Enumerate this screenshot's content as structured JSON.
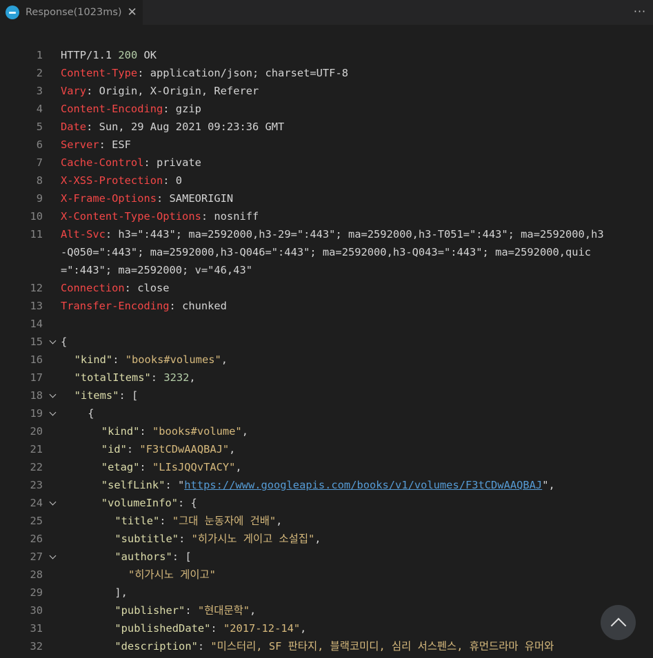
{
  "tab": {
    "icon": "rest-client-icon",
    "title": "Response(1023ms)",
    "close_glyph": "✕"
  },
  "more_glyph": "···",
  "lines": [
    {
      "n": "1",
      "fold": false,
      "indent": 0,
      "segments": [
        [
          "p",
          "HTTP/1.1 "
        ],
        [
          "n",
          "200"
        ],
        [
          "p",
          " OK"
        ]
      ]
    },
    {
      "n": "2",
      "fold": false,
      "indent": 0,
      "segments": [
        [
          "h",
          "Content-Type"
        ],
        [
          "p",
          ": application/json; charset=UTF-8"
        ]
      ]
    },
    {
      "n": "3",
      "fold": false,
      "indent": 0,
      "segments": [
        [
          "h",
          "Vary"
        ],
        [
          "p",
          ": Origin, X-Origin, Referer"
        ]
      ]
    },
    {
      "n": "4",
      "fold": false,
      "indent": 0,
      "segments": [
        [
          "h",
          "Content-Encoding"
        ],
        [
          "p",
          ": gzip"
        ]
      ]
    },
    {
      "n": "5",
      "fold": false,
      "indent": 0,
      "segments": [
        [
          "h",
          "Date"
        ],
        [
          "p",
          ": Sun, 29 Aug 2021 09:23:36 GMT"
        ]
      ]
    },
    {
      "n": "6",
      "fold": false,
      "indent": 0,
      "segments": [
        [
          "h",
          "Server"
        ],
        [
          "p",
          ": ESF"
        ]
      ]
    },
    {
      "n": "7",
      "fold": false,
      "indent": 0,
      "segments": [
        [
          "h",
          "Cache-Control"
        ],
        [
          "p",
          ": private"
        ]
      ]
    },
    {
      "n": "8",
      "fold": false,
      "indent": 0,
      "segments": [
        [
          "h",
          "X-XSS-Protection"
        ],
        [
          "p",
          ": 0"
        ]
      ]
    },
    {
      "n": "9",
      "fold": false,
      "indent": 0,
      "segments": [
        [
          "h",
          "X-Frame-Options"
        ],
        [
          "p",
          ": SAMEORIGIN"
        ]
      ]
    },
    {
      "n": "10",
      "fold": false,
      "indent": 0,
      "segments": [
        [
          "h",
          "X-Content-Type-Options"
        ],
        [
          "p",
          ": nosniff"
        ]
      ]
    },
    {
      "n": "11",
      "fold": false,
      "indent": 0,
      "segments": [
        [
          "h",
          "Alt-Svc"
        ],
        [
          "p",
          ": h3=\":443\"; ma=2592000,h3-29=\":443\"; ma=2592000,h3-T051=\":443\"; ma=2592000,h3"
        ]
      ]
    },
    {
      "n": "",
      "fold": false,
      "indent": 0,
      "segments": [
        [
          "p",
          "-Q050=\":443\"; ma=2592000,h3-Q046=\":443\"; ma=2592000,h3-Q043=\":443\"; ma=2592000,quic"
        ]
      ]
    },
    {
      "n": "",
      "fold": false,
      "indent": 0,
      "segments": [
        [
          "p",
          "=\":443\"; ma=2592000; v=\"46,43\""
        ]
      ]
    },
    {
      "n": "12",
      "fold": false,
      "indent": 0,
      "segments": [
        [
          "h",
          "Connection"
        ],
        [
          "p",
          ": close"
        ]
      ]
    },
    {
      "n": "13",
      "fold": false,
      "indent": 0,
      "segments": [
        [
          "h",
          "Transfer-Encoding"
        ],
        [
          "p",
          ": chunked"
        ]
      ]
    },
    {
      "n": "14",
      "fold": false,
      "indent": 0,
      "segments": []
    },
    {
      "n": "15",
      "fold": true,
      "indent": 0,
      "segments": [
        [
          "p",
          "{"
        ]
      ]
    },
    {
      "n": "16",
      "fold": false,
      "indent": 2,
      "segments": [
        [
          "k",
          "\"kind\""
        ],
        [
          "p",
          ": "
        ],
        [
          "s",
          "\"books#volumes\""
        ],
        [
          "p",
          ","
        ]
      ]
    },
    {
      "n": "17",
      "fold": false,
      "indent": 2,
      "segments": [
        [
          "k",
          "\"totalItems\""
        ],
        [
          "p",
          ": "
        ],
        [
          "jn",
          "3232"
        ],
        [
          "p",
          ","
        ]
      ]
    },
    {
      "n": "18",
      "fold": true,
      "indent": 2,
      "segments": [
        [
          "k",
          "\"items\""
        ],
        [
          "p",
          ": ["
        ]
      ]
    },
    {
      "n": "19",
      "fold": true,
      "indent": 4,
      "segments": [
        [
          "p",
          "{"
        ]
      ]
    },
    {
      "n": "20",
      "fold": false,
      "indent": 6,
      "segments": [
        [
          "k",
          "\"kind\""
        ],
        [
          "p",
          ": "
        ],
        [
          "s",
          "\"books#volume\""
        ],
        [
          "p",
          ","
        ]
      ]
    },
    {
      "n": "21",
      "fold": false,
      "indent": 6,
      "segments": [
        [
          "k",
          "\"id\""
        ],
        [
          "p",
          ": "
        ],
        [
          "s",
          "\"F3tCDwAAQBAJ\""
        ],
        [
          "p",
          ","
        ]
      ]
    },
    {
      "n": "22",
      "fold": false,
      "indent": 6,
      "segments": [
        [
          "k",
          "\"etag\""
        ],
        [
          "p",
          ": "
        ],
        [
          "s",
          "\"LIsJQQvTACY\""
        ],
        [
          "p",
          ","
        ]
      ]
    },
    {
      "n": "23",
      "fold": false,
      "indent": 6,
      "segments": [
        [
          "k",
          "\"selfLink\""
        ],
        [
          "p",
          ": \""
        ],
        [
          "l",
          "https://www.googleapis.com/books/v1/volumes/F3tCDwAAQBAJ"
        ],
        [
          "p",
          "\","
        ]
      ]
    },
    {
      "n": "24",
      "fold": true,
      "indent": 6,
      "segments": [
        [
          "k",
          "\"volumeInfo\""
        ],
        [
          "p",
          ": {"
        ]
      ]
    },
    {
      "n": "25",
      "fold": false,
      "indent": 8,
      "segments": [
        [
          "k",
          "\"title\""
        ],
        [
          "p",
          ": "
        ],
        [
          "s",
          "\"그대 눈동자에 건배\""
        ],
        [
          "p",
          ","
        ]
      ]
    },
    {
      "n": "26",
      "fold": false,
      "indent": 8,
      "segments": [
        [
          "k",
          "\"subtitle\""
        ],
        [
          "p",
          ": "
        ],
        [
          "s",
          "\"히가시노 게이고 소설집\""
        ],
        [
          "p",
          ","
        ]
      ]
    },
    {
      "n": "27",
      "fold": true,
      "indent": 8,
      "segments": [
        [
          "k",
          "\"authors\""
        ],
        [
          "p",
          ": ["
        ]
      ]
    },
    {
      "n": "28",
      "fold": false,
      "indent": 10,
      "segments": [
        [
          "s",
          "\"히가시노 게이고\""
        ]
      ]
    },
    {
      "n": "29",
      "fold": false,
      "indent": 8,
      "segments": [
        [
          "p",
          "],"
        ]
      ]
    },
    {
      "n": "30",
      "fold": false,
      "indent": 8,
      "segments": [
        [
          "k",
          "\"publisher\""
        ],
        [
          "p",
          ": "
        ],
        [
          "s",
          "\"현대문학\""
        ],
        [
          "p",
          ","
        ]
      ]
    },
    {
      "n": "31",
      "fold": false,
      "indent": 8,
      "segments": [
        [
          "k",
          "\"publishedDate\""
        ],
        [
          "p",
          ": "
        ],
        [
          "s",
          "\"2017-12-14\""
        ],
        [
          "p",
          ","
        ]
      ]
    },
    {
      "n": "32",
      "fold": false,
      "indent": 8,
      "segments": [
        [
          "k",
          "\"description\""
        ],
        [
          "p",
          ": "
        ],
        [
          "s",
          "\"미스터리, SF 판타지, 블랙코미디, 심리 서스펜스, 휴먼드라마 유머와"
        ]
      ]
    }
  ],
  "scroll_top_icon": "chevron-up-icon"
}
